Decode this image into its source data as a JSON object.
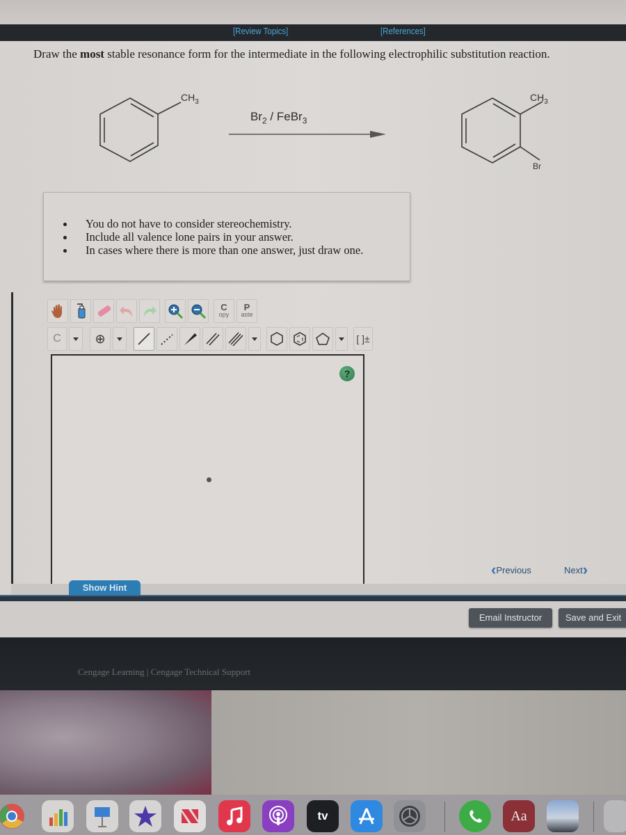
{
  "header": {
    "review_topics": "[Review Topics]",
    "references": "[References]"
  },
  "question": {
    "prefix": "Draw the ",
    "emphasis": "most",
    "suffix": " stable resonance form for the intermediate in the following electrophilic substitution reaction."
  },
  "reaction": {
    "reactant_substituent": "CH",
    "reactant_sub": "3",
    "reagent_br": "Br",
    "reagent_br_sub": "2",
    "reagent_sep": " / FeBr",
    "reagent_fe_sub": "3",
    "product_substituent_1": "CH",
    "product_sub_1": "3",
    "product_substituent_2": "Br"
  },
  "notes": [
    "You do not have to consider stereochemistry.",
    "Include all valence lone pairs in your answer.",
    "In cases where there is more than one answer, just draw one."
  ],
  "toolbar": {
    "row1": [
      "hand-tool",
      "lasso-bottle-tool",
      "eraser-tool",
      "undo",
      "redo",
      "zoom-in",
      "zoom-out",
      "copy",
      "paste"
    ],
    "copy_big": "C",
    "copy_small": "opy",
    "paste_big": "P",
    "paste_small": "aste",
    "element_label": "C",
    "charge_label": "⊕",
    "bracket_label": "[ ]±"
  },
  "help_label": "?",
  "navigation": {
    "previous": "Previous",
    "next": "Next"
  },
  "buttons": {
    "show_hint": "Show Hint",
    "email_instructor": "Email Instructor",
    "save_and_exit": "Save and Exit"
  },
  "footer": {
    "text": "Cengage Learning  |  Cengage Technical Support"
  },
  "dock": {
    "tv_label": "tv",
    "dictionary_label": "Aa"
  }
}
